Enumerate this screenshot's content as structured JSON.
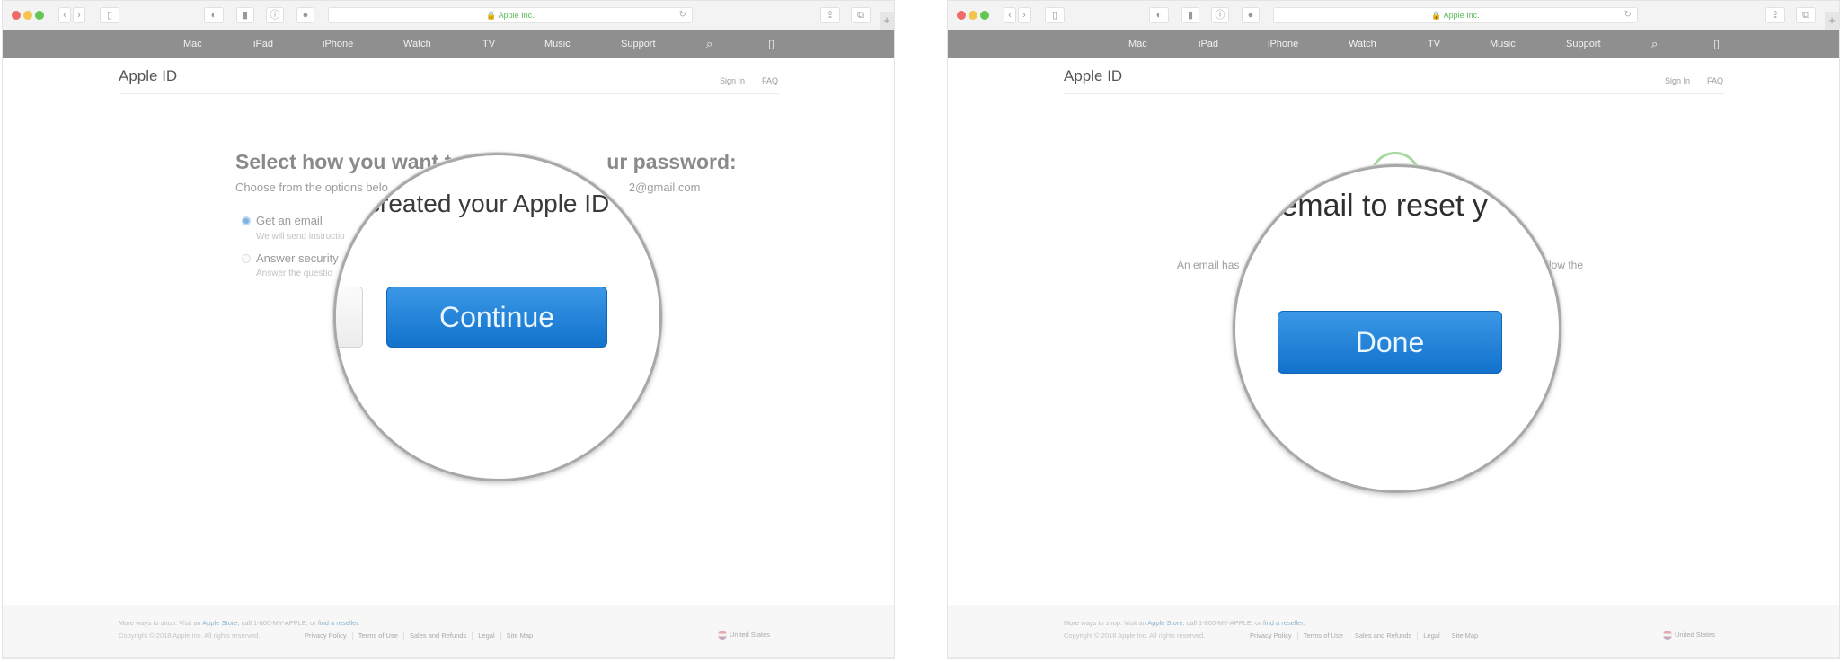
{
  "browser": {
    "address": "Apple Inc.",
    "lock_icon": "lock-icon",
    "toolbar_icons": [
      "back-icon",
      "forward-icon",
      "sidebar-icon",
      "toggle-icon",
      "ghostery-icon",
      "info-icon",
      "grammarly-icon",
      "reload-icon",
      "share-icon",
      "tabs-icon",
      "new-tab-icon"
    ]
  },
  "nav": {
    "items": [
      "Mac",
      "iPad",
      "iPhone",
      "Watch",
      "TV",
      "Music",
      "Support"
    ],
    "apple_icon": "",
    "search_icon": "⌕",
    "bag_icon": "▯"
  },
  "header": {
    "title": "Apple ID",
    "sign_in": "Sign In",
    "faq": "FAQ"
  },
  "left": {
    "title": "Select how you want to reset your password:",
    "title_visible_left": "Select how you want t",
    "title_visible_right": "ur password:",
    "subtitle_visible_left": "Choose from the options belo",
    "subtitle_visible_right": "2@gmail.com",
    "options": [
      {
        "label": "Get an email",
        "desc": "We will send instructio",
        "selected": true
      },
      {
        "label": "Answer security",
        "desc": "Answer the questio",
        "selected": false
      }
    ],
    "magnified_text": "created your Apple ID",
    "continue_label": "Continue"
  },
  "right": {
    "magnified_text": "e email to reset y",
    "body_left": "An email has",
    "body_right": "n. Follow the",
    "done_label": "Done"
  },
  "footer": {
    "shop_prefix": "More ways to shop: Visit an ",
    "apple_store": "Apple Store",
    "shop_mid": ", call 1-800-MY-APPLE, or ",
    "find_reseller": "find a reseller",
    "shop_suffix": ".",
    "copyright": "Copyright © 2018 Apple Inc. All rights reserved.",
    "links": [
      "Privacy Policy",
      "Terms of Use",
      "Sales and Refunds",
      "Legal",
      "Site Map"
    ],
    "country": "United States"
  },
  "colors": {
    "accent_blue": "#1a7fd8",
    "nav_gray": "#8f8f8f",
    "lock_green": "#5cba5c"
  }
}
